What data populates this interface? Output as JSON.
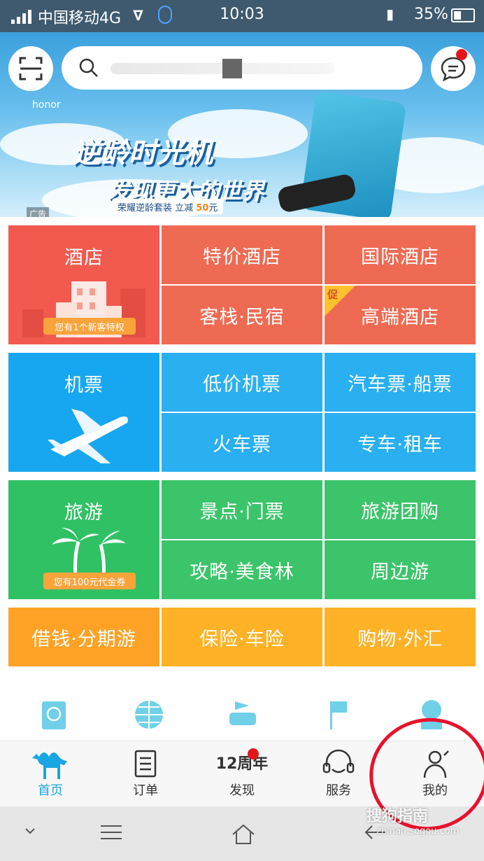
{
  "status_bar": {
    "carrier": "中国移动4G",
    "time": "10:03",
    "battery": "35%"
  },
  "banner": {
    "brand": "honor",
    "headline_line1": "逆龄时光机",
    "headline_line2": "发现更大的世界",
    "promo_text": "荣耀逆龄套装 立减",
    "promo_amount": "50",
    "promo_unit": "元",
    "ad_label": "广告"
  },
  "grid": {
    "hotel": {
      "main": "酒店",
      "badge": "您有1个新客特权",
      "sub1": "特价酒店",
      "sub2": "国际酒店",
      "sub3": "客栈·民宿",
      "sub4": "高端酒店",
      "sub4_tag": "促"
    },
    "flight": {
      "main": "机票",
      "sub1": "低价机票",
      "sub2": "汽车票·船票",
      "sub3": "火车票",
      "sub4": "专车·租车"
    },
    "travel": {
      "main": "旅游",
      "badge": "您有100元代金券",
      "sub1": "景点·门票",
      "sub2": "旅游团购",
      "sub3": "攻略·美食林",
      "sub4": "周边游"
    },
    "finance": {
      "sub1": "借钱·分期游",
      "sub2": "保险·车险",
      "sub3": "购物·外汇"
    }
  },
  "tabs": [
    {
      "label": "首页",
      "icon": "camel-icon"
    },
    {
      "label": "订单",
      "icon": "order-list-icon"
    },
    {
      "label": "发现",
      "icon": "anniversary-12-icon",
      "icon_text": "12周年"
    },
    {
      "label": "服务",
      "icon": "headset-icon"
    },
    {
      "label": "我的",
      "icon": "person-icon"
    }
  ],
  "watermark": {
    "brand": "搜狗指南",
    "url": "zhinan.sogou.com"
  },
  "colors": {
    "accent": "#1aa6e0",
    "hotel": "#f25a4f",
    "flight": "#16a7f0",
    "travel": "#30c164",
    "finance": "#ffa225"
  }
}
